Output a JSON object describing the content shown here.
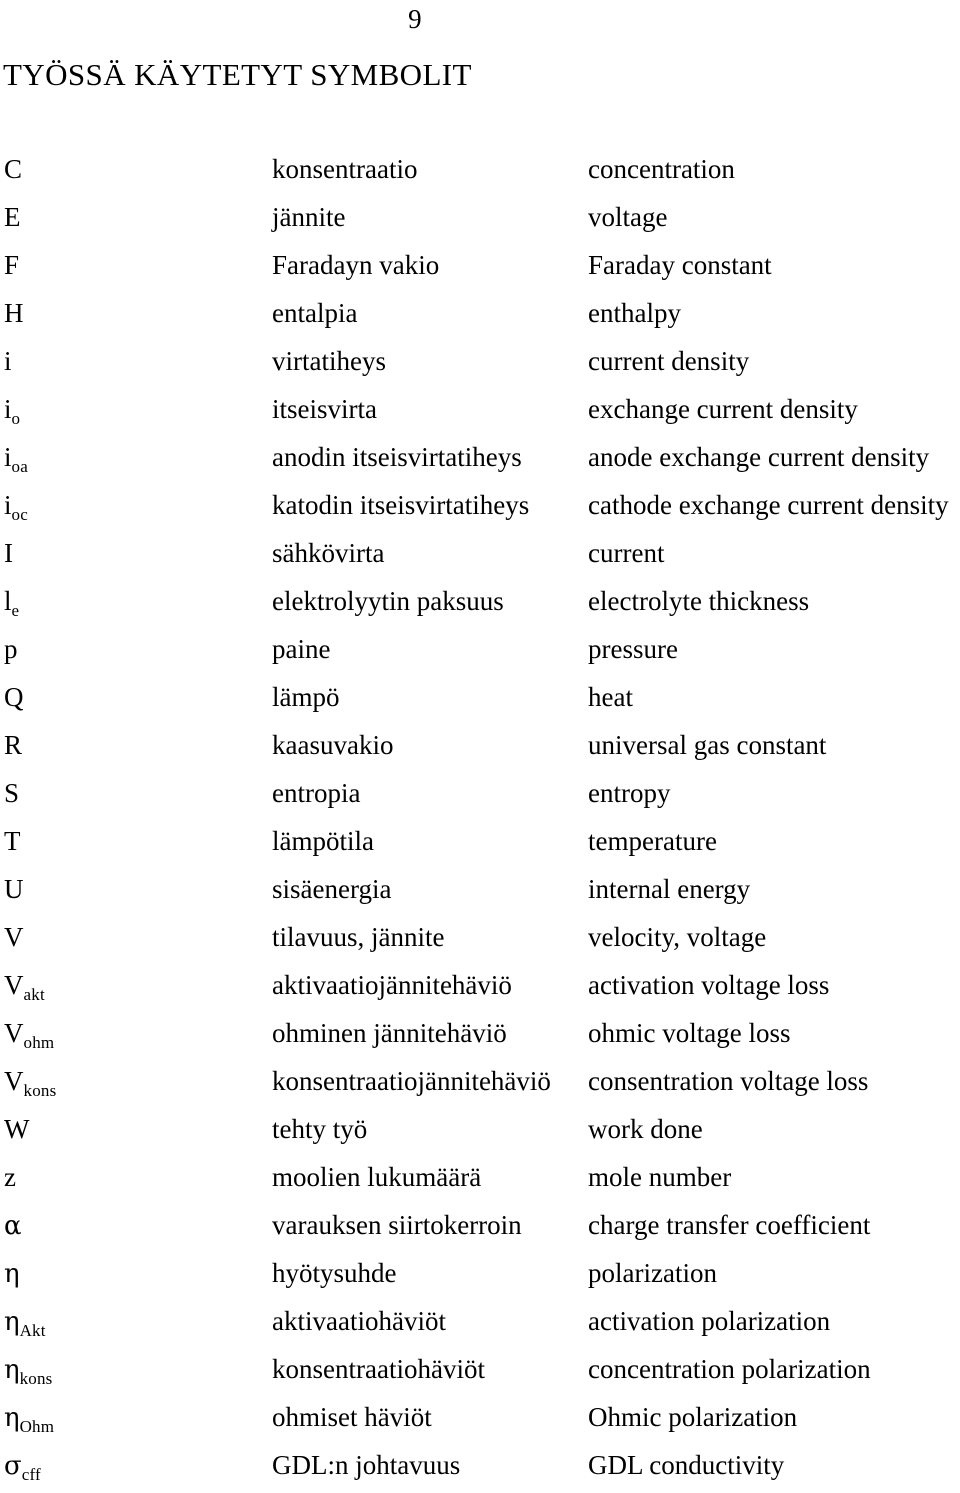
{
  "document": {
    "page_number": "9",
    "title": "TYÖSSÄ KÄYTETYT SYMBOLIT"
  },
  "symbols": [
    {
      "symbol": "C",
      "sub": "",
      "finnish": "konsentraatio",
      "english": "concentration"
    },
    {
      "symbol": "E",
      "sub": "",
      "finnish": "jännite",
      "english": "voltage"
    },
    {
      "symbol": "F",
      "sub": "",
      "finnish": "Faradayn vakio",
      "english": "Faraday constant"
    },
    {
      "symbol": "H",
      "sub": "",
      "finnish": "entalpia",
      "english": "enthalpy"
    },
    {
      "symbol": "i",
      "sub": "",
      "finnish": "virtatiheys",
      "english": "current density"
    },
    {
      "symbol": "i",
      "sub": "o",
      "finnish": "itseisvirta",
      "english": "exchange current density"
    },
    {
      "symbol": "i",
      "sub": "oa",
      "finnish": "anodin itseisvirtatiheys",
      "english": "anode exchange current density"
    },
    {
      "symbol": "i",
      "sub": "oc",
      "finnish": "katodin itseisvirtatiheys",
      "english": "cathode exchange current density"
    },
    {
      "symbol": "I",
      "sub": "",
      "finnish": "sähkövirta",
      "english": "current"
    },
    {
      "symbol": "l",
      "sub": "e",
      "finnish": "elektrolyytin paksuus",
      "english": "electrolyte thickness"
    },
    {
      "symbol": "p",
      "sub": "",
      "finnish": "paine",
      "english": "pressure"
    },
    {
      "symbol": "Q",
      "sub": "",
      "finnish": "lämpö",
      "english": "heat"
    },
    {
      "symbol": "R",
      "sub": "",
      "finnish": "kaasuvakio",
      "english": "universal gas constant"
    },
    {
      "symbol": "S",
      "sub": "",
      "finnish": "entropia",
      "english": "entropy"
    },
    {
      "symbol": "T",
      "sub": "",
      "finnish": "lämpötila",
      "english": "temperature"
    },
    {
      "symbol": "U",
      "sub": "",
      "finnish": "sisäenergia",
      "english": "internal energy"
    },
    {
      "symbol": "V",
      "sub": "",
      "finnish": "tilavuus, jännite",
      "english": "velocity, voltage"
    },
    {
      "symbol": "V",
      "sub": "akt",
      "finnish": "aktivaatiojännitehäviö",
      "english": "activation voltage loss"
    },
    {
      "symbol": "V",
      "sub": "ohm",
      "finnish": "ohminen jännitehäviö",
      "english": "ohmic voltage loss"
    },
    {
      "symbol": "V",
      "sub": "kons",
      "finnish": "konsentraatiojännitehäviö",
      "english": "consentration voltage loss"
    },
    {
      "symbol": "W",
      "sub": "",
      "finnish": "tehty työ",
      "english": "work done"
    },
    {
      "symbol": "z",
      "sub": "",
      "finnish": "moolien lukumäärä",
      "english": "mole number"
    },
    {
      "symbol": "α",
      "sub": "",
      "finnish": "varauksen siirtokerroin",
      "english": "charge transfer coefficient"
    },
    {
      "symbol": "η",
      "sub": "",
      "finnish": "hyötysuhde",
      "english": "polarization"
    },
    {
      "symbol": "η",
      "sub": "Akt",
      "finnish": "aktivaatiohäviöt",
      "english": "activation polarization"
    },
    {
      "symbol": "η",
      "sub": "kons",
      "finnish": "konsentraatiohäviöt",
      "english": "concentration polarization"
    },
    {
      "symbol": "η",
      "sub": "Ohm",
      "finnish": "ohmiset häviöt",
      "english": "Ohmic polarization"
    },
    {
      "symbol": "σ",
      "sub": "cff",
      "finnish": "GDL:n johtavuus",
      "english": "GDL conductivity"
    }
  ]
}
